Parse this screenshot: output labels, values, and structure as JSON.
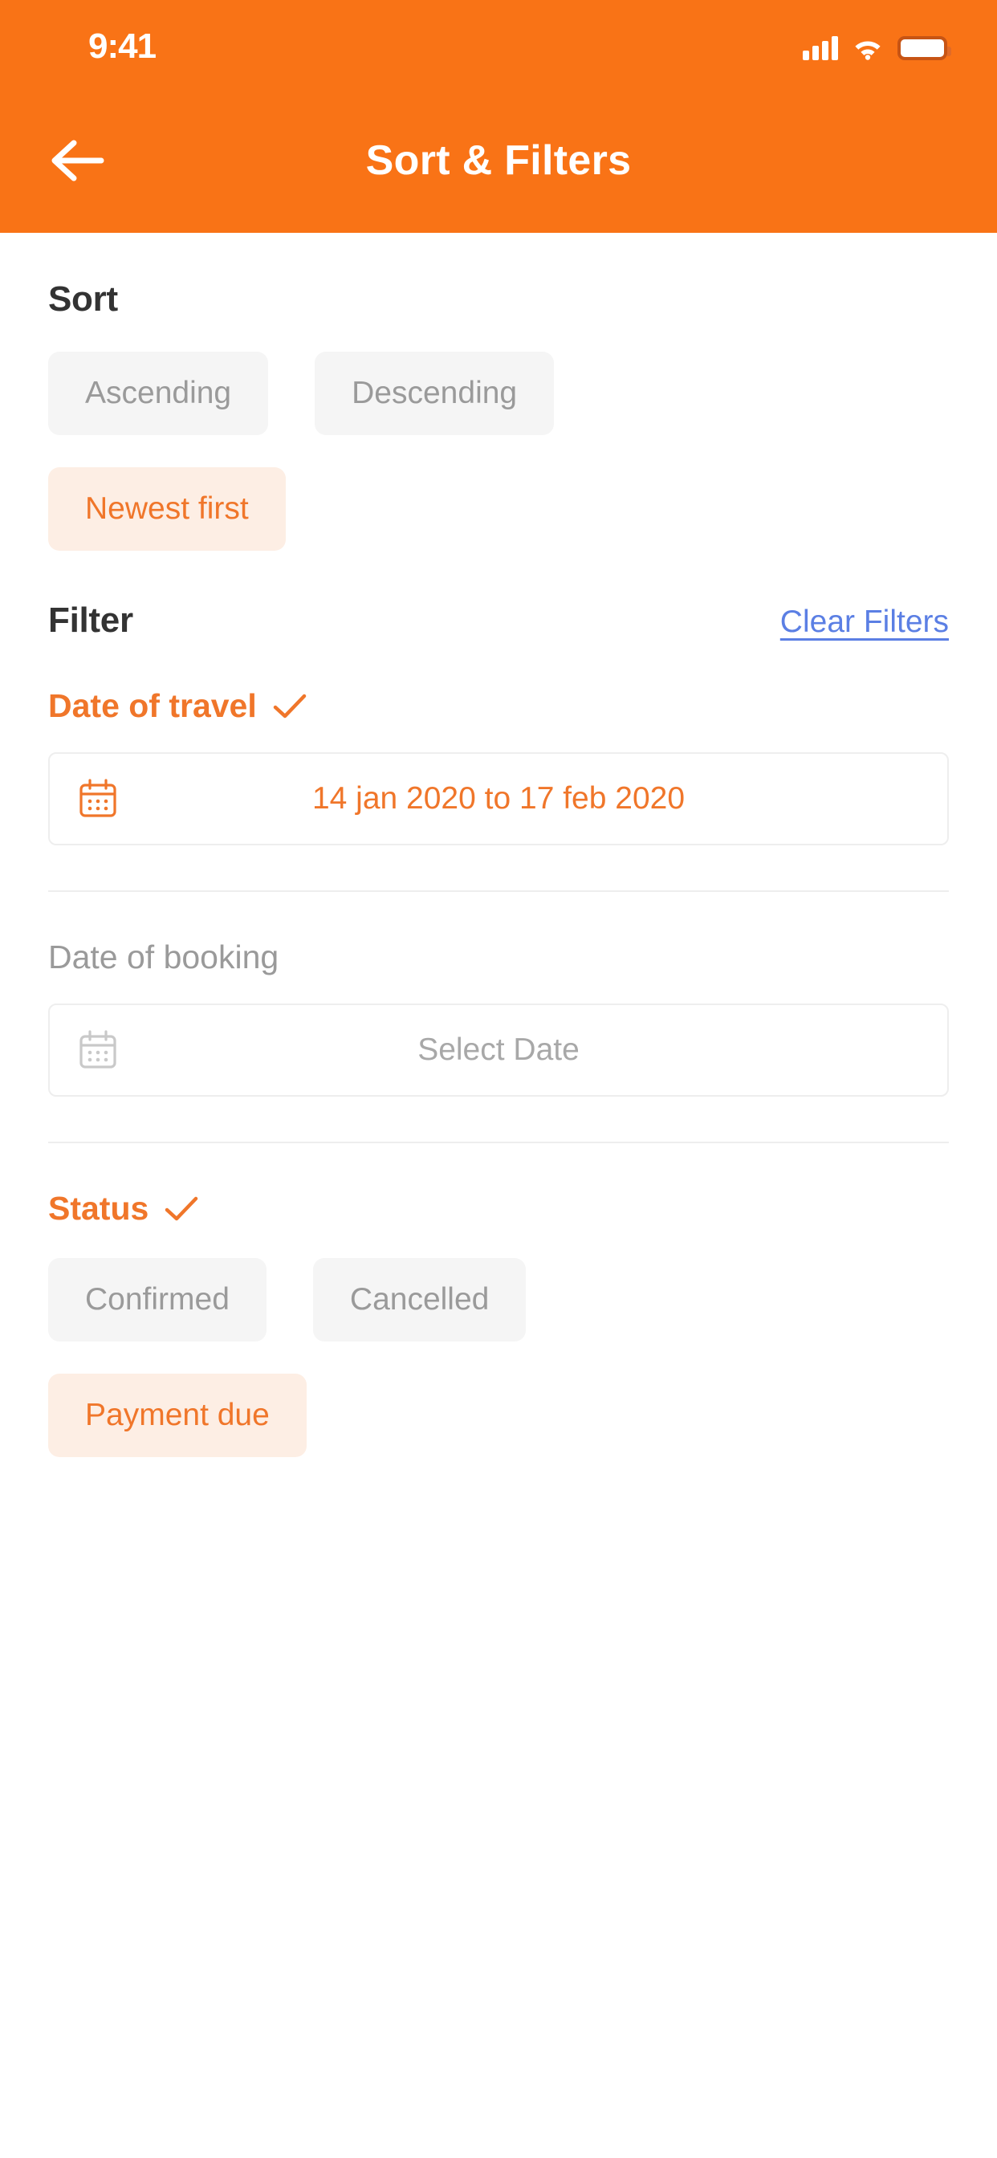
{
  "status_bar": {
    "time": "9:41",
    "signal_icon": "cellular-signal-icon",
    "wifi_icon": "wifi-icon",
    "battery_icon": "battery-full-icon"
  },
  "header": {
    "title": "Sort & Filters",
    "back_icon": "back-arrow-icon",
    "background_color": "#f97316"
  },
  "sort": {
    "title": "Sort",
    "options": [
      {
        "label": "Ascending",
        "selected": false
      },
      {
        "label": "Descending",
        "selected": false
      },
      {
        "label": "Newest first",
        "selected": true
      }
    ]
  },
  "filter": {
    "title": "Filter",
    "clear_label": "Clear Filters",
    "clear_color": "#5b7fe4",
    "groups": [
      {
        "label": "Date of travel",
        "active": true,
        "check_icon": "check-icon",
        "field": {
          "icon": "calendar-icon",
          "value": "14 jan 2020 to 17 feb 2020",
          "placeholder": "Select Date",
          "filled": true
        }
      },
      {
        "label": "Date of booking",
        "active": false,
        "check_icon": "check-icon",
        "field": {
          "icon": "calendar-icon",
          "value": "",
          "placeholder": "Select Date",
          "filled": false
        }
      }
    ],
    "status_group": {
      "label": "Status",
      "active": true,
      "check_icon": "check-icon",
      "options": [
        {
          "label": "Confirmed",
          "selected": false
        },
        {
          "label": "Cancelled",
          "selected": false
        },
        {
          "label": "Payment due",
          "selected": true
        }
      ]
    }
  },
  "colors": {
    "accent": "#f0762a",
    "accent_header": "#f97316",
    "chip_bg": "#f5f5f5",
    "chip_selected_bg": "#fdeee4",
    "link": "#5b7fe4",
    "muted_text": "#9a9a9a"
  }
}
